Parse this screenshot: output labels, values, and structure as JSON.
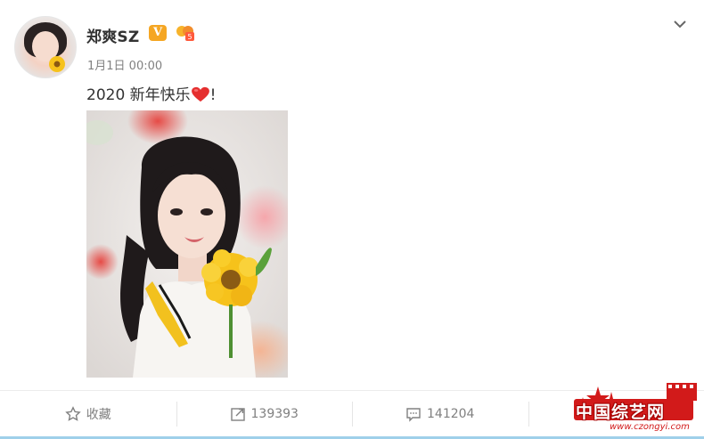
{
  "post": {
    "author": "郑爽SZ",
    "verified_badge": "V",
    "timestamp": "1月1日 00:00",
    "text": "2020 新年快乐",
    "text_suffix": "!",
    "image_alt": "Portrait photo with sunflower"
  },
  "actions": {
    "favorite_label": "收藏",
    "repost_count": "139393",
    "comment_count": "141204"
  },
  "watermark": {
    "text": "中国综艺网",
    "url": "www.czongyi.com"
  },
  "colors": {
    "badge": "#f5a623",
    "heart": "#e52f2f",
    "watermark": "#d21a1a",
    "bottom_border": "#9fd0ea"
  },
  "icons": {
    "menu": "chevron-down-icon",
    "favorite": "star-icon",
    "repost": "share-icon",
    "comment": "comment-icon"
  }
}
